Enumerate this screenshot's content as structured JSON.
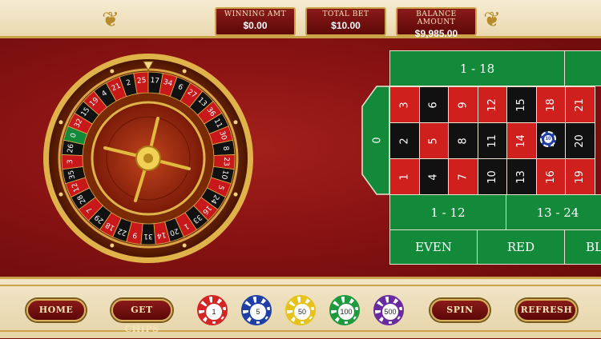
{
  "header": {
    "winning_label": "WINNING AMT",
    "winning_value": "$0.00",
    "total_bet_label": "TOTAL BET",
    "total_bet_value": "$10.00",
    "balance_label": "BALANCE AMOUNT",
    "balance_value": "$9,985.00"
  },
  "wheel": {
    "numbers": [
      "0",
      "32",
      "15",
      "19",
      "4",
      "21",
      "2",
      "25",
      "17",
      "34",
      "6",
      "27",
      "13",
      "36",
      "11",
      "30",
      "8",
      "23",
      "10",
      "5",
      "24",
      "16",
      "33",
      "1",
      "20",
      "14",
      "31",
      "9",
      "22",
      "18",
      "29",
      "7",
      "28",
      "12",
      "35",
      "3",
      "26"
    ],
    "red_numbers": [
      "1",
      "3",
      "5",
      "7",
      "9",
      "12",
      "14",
      "16",
      "18",
      "19",
      "21",
      "23",
      "25",
      "27",
      "30",
      "32",
      "34",
      "36"
    ]
  },
  "table": {
    "zero": "0",
    "rows": [
      [
        "3",
        "6",
        "9",
        "12",
        "15",
        "18",
        "21"
      ],
      [
        "2",
        "5",
        "8",
        "11",
        "14",
        "17",
        "20"
      ],
      [
        "1",
        "4",
        "7",
        "10",
        "13",
        "16",
        "19"
      ]
    ],
    "colors": [
      [
        "red",
        "blk",
        "red",
        "red",
        "blk",
        "red",
        "red"
      ],
      [
        "blk",
        "red",
        "blk",
        "blk",
        "red",
        "blk",
        "blk"
      ],
      [
        "red",
        "blk",
        "red",
        "blk",
        "blk",
        "red",
        "red"
      ]
    ],
    "top_bets": [
      "1 - 18",
      ""
    ],
    "dozens": [
      "1 - 12",
      "13 - 24"
    ],
    "even_money": [
      "EVEN",
      "RED",
      "BL"
    ],
    "placed_chip_value": "10"
  },
  "buttons": {
    "home": "HOME",
    "get_chips": "GET CHIPS",
    "spin": "SPIN",
    "refresh": "REFRESH"
  },
  "chips": [
    {
      "value": "1",
      "color": "#d42424"
    },
    {
      "value": "5",
      "color": "#1f3fa6"
    },
    {
      "value": "50",
      "color": "#e6c21a"
    },
    {
      "value": "100",
      "color": "#1e9a3e"
    },
    {
      "value": "500",
      "color": "#6a2aa0"
    }
  ],
  "colors": {
    "felt": "#8a1313",
    "gold": "#c9a24a",
    "table_green": "#138a3a"
  }
}
